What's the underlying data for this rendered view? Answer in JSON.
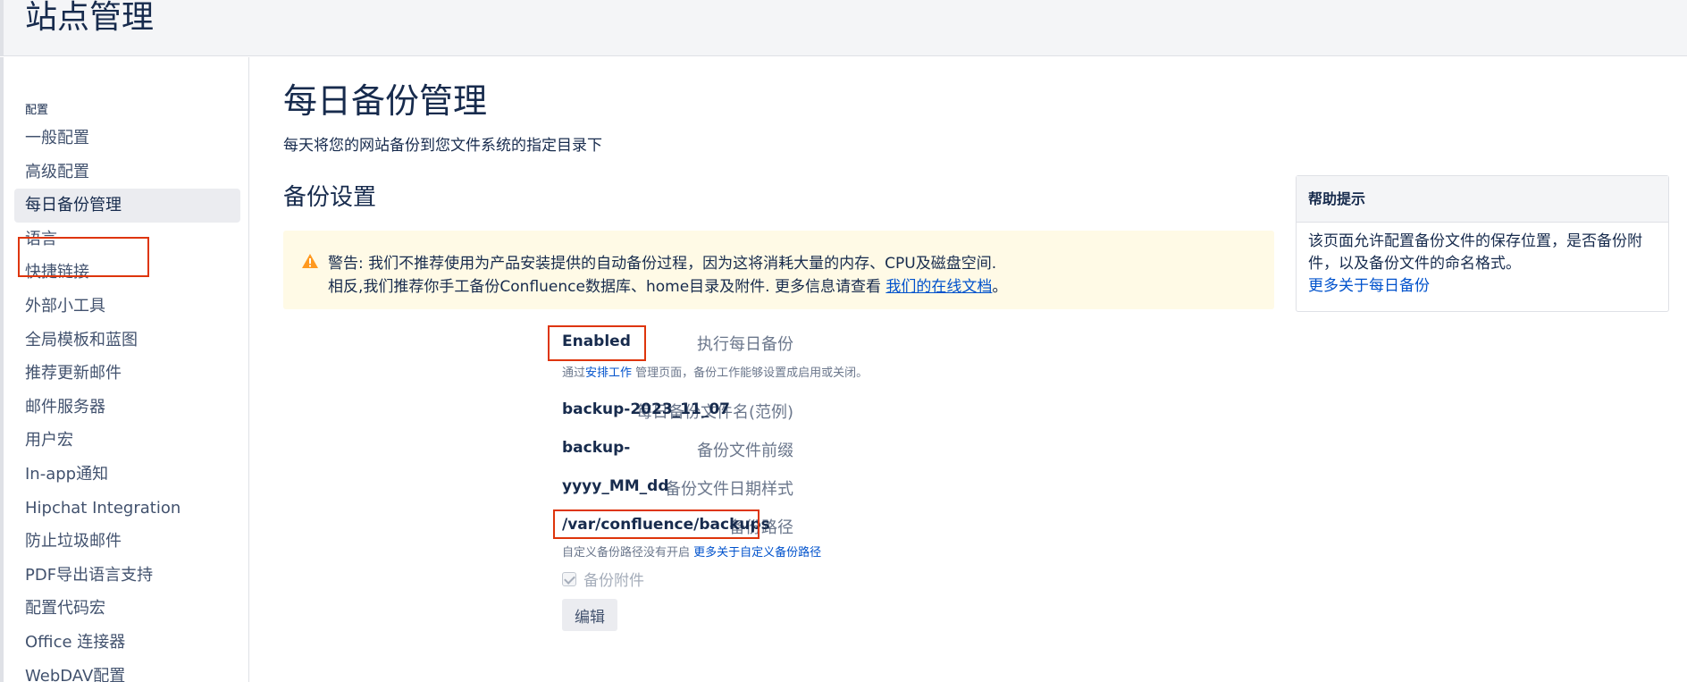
{
  "header": {
    "title": "站点管理"
  },
  "sidebar": {
    "section": "配置",
    "items": [
      {
        "label": "一般配置"
      },
      {
        "label": "高级配置"
      },
      {
        "label": "每日备份管理"
      },
      {
        "label": "语言"
      },
      {
        "label": "快捷链接"
      },
      {
        "label": "外部小工具"
      },
      {
        "label": "全局模板和蓝图"
      },
      {
        "label": "推荐更新邮件"
      },
      {
        "label": "邮件服务器"
      },
      {
        "label": "用户宏"
      },
      {
        "label": "In-app通知"
      },
      {
        "label": "Hipchat Integration"
      },
      {
        "label": "防止垃圾邮件"
      },
      {
        "label": "PDF导出语言支持"
      },
      {
        "label": "配置代码宏"
      },
      {
        "label": "Office 连接器"
      },
      {
        "label": "WebDAV配置"
      }
    ]
  },
  "main": {
    "title": "每日备份管理",
    "description": "每天将您的网站备份到您文件系统的指定目录下",
    "section_title": "备份设置",
    "warning": {
      "line1": "警告: 我们不推荐使用为产品安装提供的自动备份过程，因为这将消耗大量的内存、CPU及磁盘空间.",
      "line2_prefix": "相反,我们推荐你手工备份Confluence数据库、home目录及附件. 更多信息请查看 ",
      "line2_link": "我们的在线文档",
      "line2_suffix": "。"
    },
    "form": {
      "daily_backup_label": "执行每日备份",
      "daily_backup_value": "Enabled",
      "schedule_hint_prefix": "通过",
      "schedule_hint_link": "安排工作",
      "schedule_hint_suffix": " 管理页面，备份工作能够设置成启用或关闭。",
      "filename_label": "每日备份文件名(范例)",
      "filename_value": "backup-2023_11_07",
      "prefix_label": "备份文件前缀",
      "prefix_value": "backup-",
      "date_format_label": "备份文件日期样式",
      "date_format_value": "yyyy_MM_dd",
      "path_label": "备份路径",
      "path_value": "/var/confluence/backups",
      "path_hint_prefix": "自定义备份路径没有开启 ",
      "path_hint_link": "更多关于自定义备份路径",
      "attachments_label": "备份附件",
      "edit_label": "编辑"
    }
  },
  "help": {
    "title": "帮助提示",
    "body": "该页面允许配置备份文件的保存位置，是否备份附件，以及备份文件的命名格式。",
    "link": "更多关于每日备份"
  },
  "colors": {
    "highlight": "#de350b",
    "link": "#0052cc",
    "warning_bg": "#fffae6"
  }
}
